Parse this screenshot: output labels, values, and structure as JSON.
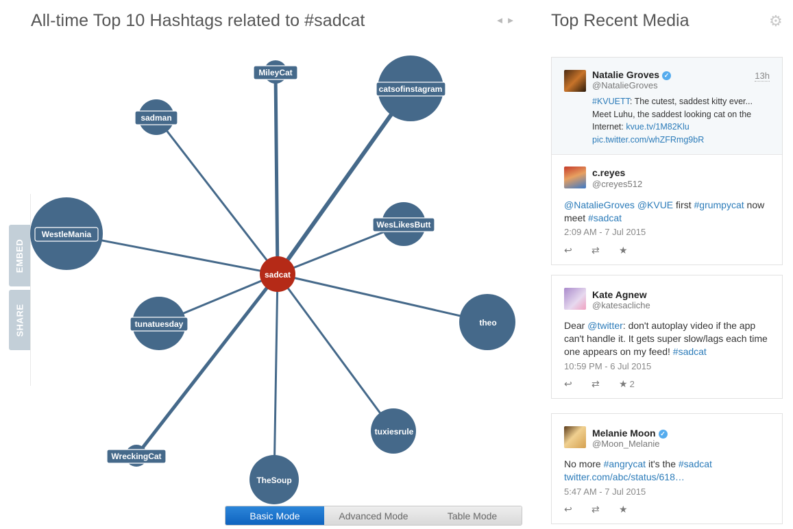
{
  "left": {
    "title": "All-time Top 10 Hashtags related to #sadcat",
    "prev_arrow": "◄",
    "next_arrow": "►"
  },
  "side_tabs": {
    "embed": "EMBED",
    "share": "SHARE"
  },
  "graph": {
    "center": "sadcat",
    "nodes": [
      "MileyCat",
      "catsofinstagram",
      "sadman",
      "WestleMania",
      "WesLikesButt",
      "tunatuesday",
      "theo",
      "tuxiesrule",
      "WreckingCat",
      "TheSoup"
    ],
    "colors": {
      "node": "#45698a",
      "center": "#b52a17"
    }
  },
  "modes": {
    "basic": "Basic Mode",
    "advanced": "Advanced Mode",
    "table": "Table Mode",
    "active": "basic"
  },
  "right": {
    "title": "Top Recent Media",
    "settings_icon": "gear-icon"
  },
  "tweets": [
    {
      "name": "Natalie Groves",
      "handle": "@NatalieGroves",
      "time": "13h",
      "verified": true,
      "text_parts": [
        {
          "t": "#KVUETT",
          "link": true
        },
        {
          "t": ": The cutest, saddest kitty ever... Meet Luhu, the saddest looking cat on the Internet: ",
          "link": false
        },
        {
          "t": "kvue.tv/1M82Klu",
          "link": true
        },
        {
          "t": " ",
          "link": false
        },
        {
          "t": "pic.twitter.com/whZFRmg9bR",
          "link": true
        }
      ]
    },
    {
      "name": "c.reyes",
      "handle": "@creyes512",
      "verified": false,
      "date": "2:09 AM - 7 Jul 2015",
      "text_parts": [
        {
          "t": "@NatalieGroves",
          "link": true
        },
        {
          "t": " ",
          "link": false
        },
        {
          "t": "@KVUE",
          "link": true
        },
        {
          "t": " first ",
          "link": false
        },
        {
          "t": "#grumpycat",
          "link": true
        },
        {
          "t": " now meet ",
          "link": false
        },
        {
          "t": "#sadcat",
          "link": true
        }
      ]
    },
    {
      "name": "Kate Agnew",
      "handle": "@katesacliche",
      "verified": false,
      "date": "10:59 PM - 6 Jul 2015",
      "favorites": "2",
      "text_parts": [
        {
          "t": "Dear ",
          "link": false
        },
        {
          "t": "@twitter",
          "link": true
        },
        {
          "t": ": don't autoplay video if the app can't handle it. It gets super slow/lags each time one appears on my feed! ",
          "link": false
        },
        {
          "t": "#sadcat",
          "link": true
        }
      ]
    },
    {
      "name": "Melanie Moon",
      "handle": "@Moon_Melanie",
      "verified": true,
      "date": "5:47 AM - 7 Jul 2015",
      "text_parts": [
        {
          "t": "No more ",
          "link": false
        },
        {
          "t": "#angrycat",
          "link": true
        },
        {
          "t": " it's the ",
          "link": false
        },
        {
          "t": "#sadcat",
          "link": true
        },
        {
          "t": " ",
          "link": false
        },
        {
          "t": "twitter.com/abc/status/618…",
          "link": true
        }
      ]
    }
  ]
}
